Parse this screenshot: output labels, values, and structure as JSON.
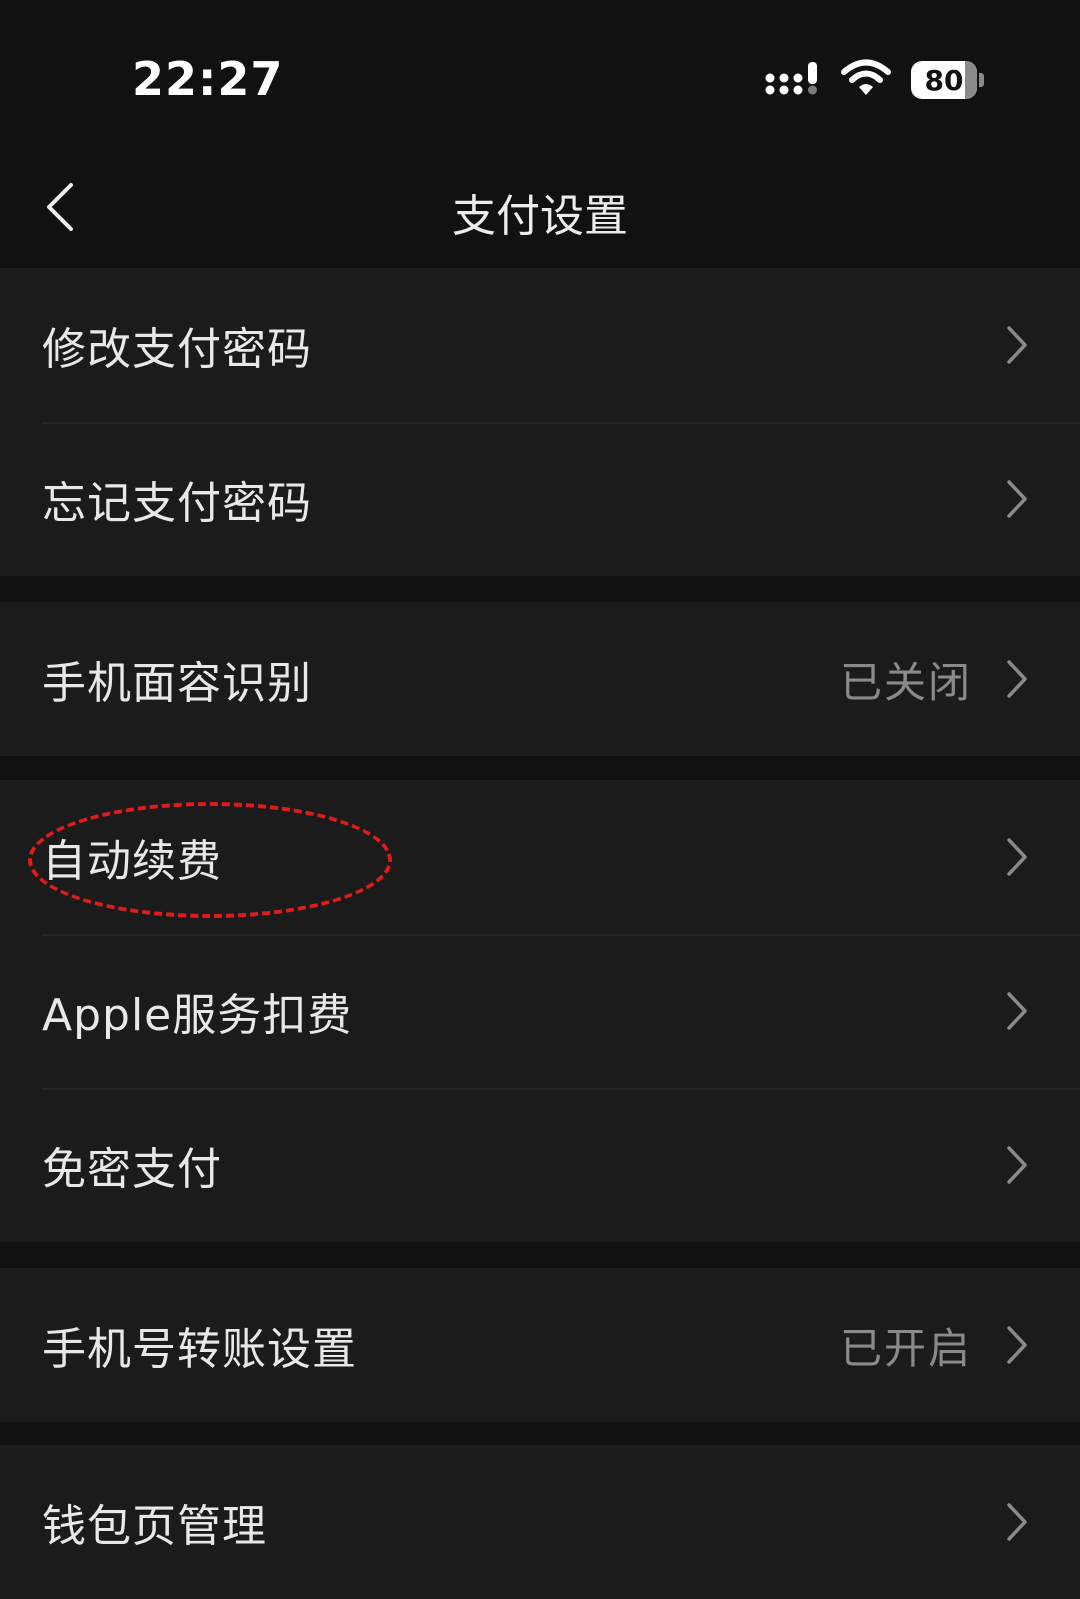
{
  "status_bar": {
    "time": "22:27",
    "battery_level": "80",
    "icons": [
      "signal-icon",
      "wifi-icon",
      "battery-icon"
    ]
  },
  "nav": {
    "title": "支付设置",
    "back_icon": "chevron-left-icon"
  },
  "groups": [
    {
      "items": [
        {
          "label": "修改支付密码",
          "value": ""
        },
        {
          "label": "忘记支付密码",
          "value": ""
        }
      ]
    },
    {
      "items": [
        {
          "label": "手机面容识别",
          "value": "已关闭"
        }
      ]
    },
    {
      "items": [
        {
          "label": "自动续费",
          "value": ""
        },
        {
          "label": "Apple服务扣费",
          "value": ""
        },
        {
          "label": "免密支付",
          "value": ""
        }
      ]
    },
    {
      "items": [
        {
          "label": "手机号转账设置",
          "value": "已开启"
        }
      ]
    },
    {
      "items": [
        {
          "label": "钱包页管理",
          "value": ""
        }
      ]
    }
  ],
  "colors": {
    "background": "#111111",
    "row_background": "#1b1b1b",
    "text_primary": "#e8e8e8",
    "text_secondary": "#8a8a8a",
    "highlight": "#e01b1b"
  }
}
